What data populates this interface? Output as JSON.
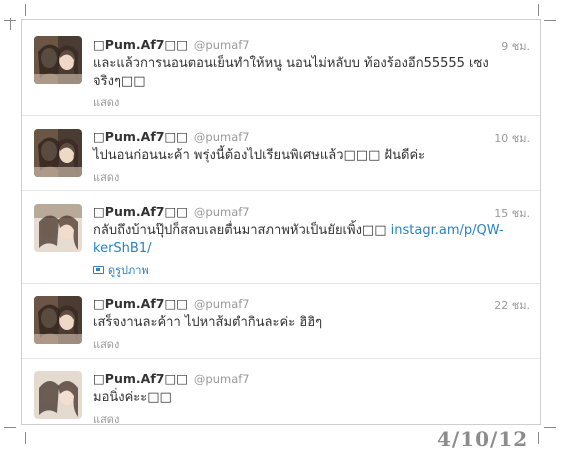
{
  "tweets": [
    {
      "fullname": "□Pum.Af7□□",
      "username": "@pumaf7",
      "time": "9 ชม.",
      "text": "และแล้วการนอนตอนเย็นทำให้หนู นอนไม่หลับบ ท้องร้องอีก55555 เซงจริงๆ□□",
      "expand": "แสดง"
    },
    {
      "fullname": "□Pum.Af7□□",
      "username": "@pumaf7",
      "time": "10 ชม.",
      "text": "ไปนอนก่อนนะค้า พรุ่งนี้ต้องไปเรียนพิเศษแล้ว□□□ ฝันดีค่ะ",
      "expand": "แสดง"
    },
    {
      "fullname": "□Pum.Af7□□",
      "username": "@pumaf7",
      "time": "15 ชม.",
      "text": "กลับถึงบ้านปุ๊ปก็สลบเลยตื่นมาสภาพหัวเป็นยัยเพิ้ง□□ ",
      "link": "instagr.am/p/QW-kerShB1/",
      "photo": "ดูรูปภาพ",
      "expand": ""
    },
    {
      "fullname": "□Pum.Af7□□",
      "username": "@pumaf7",
      "time": "22 ชม.",
      "text": "เสร็จงานละค้าา ไปหาส้มตำกินละค่ะ ฮิฮิๆ",
      "expand": "แสดง"
    },
    {
      "fullname": "□Pum.Af7□□",
      "username": "@pumaf7",
      "time": "",
      "text": "มอนิ่งค่ะะ□□",
      "expand": "แสดง"
    }
  ],
  "footer": {
    "date": "4/10/12"
  },
  "colors": {
    "link": "#2a82c5",
    "muted": "#999999",
    "text": "#333333",
    "date_stamp": "#8c8c8c"
  }
}
